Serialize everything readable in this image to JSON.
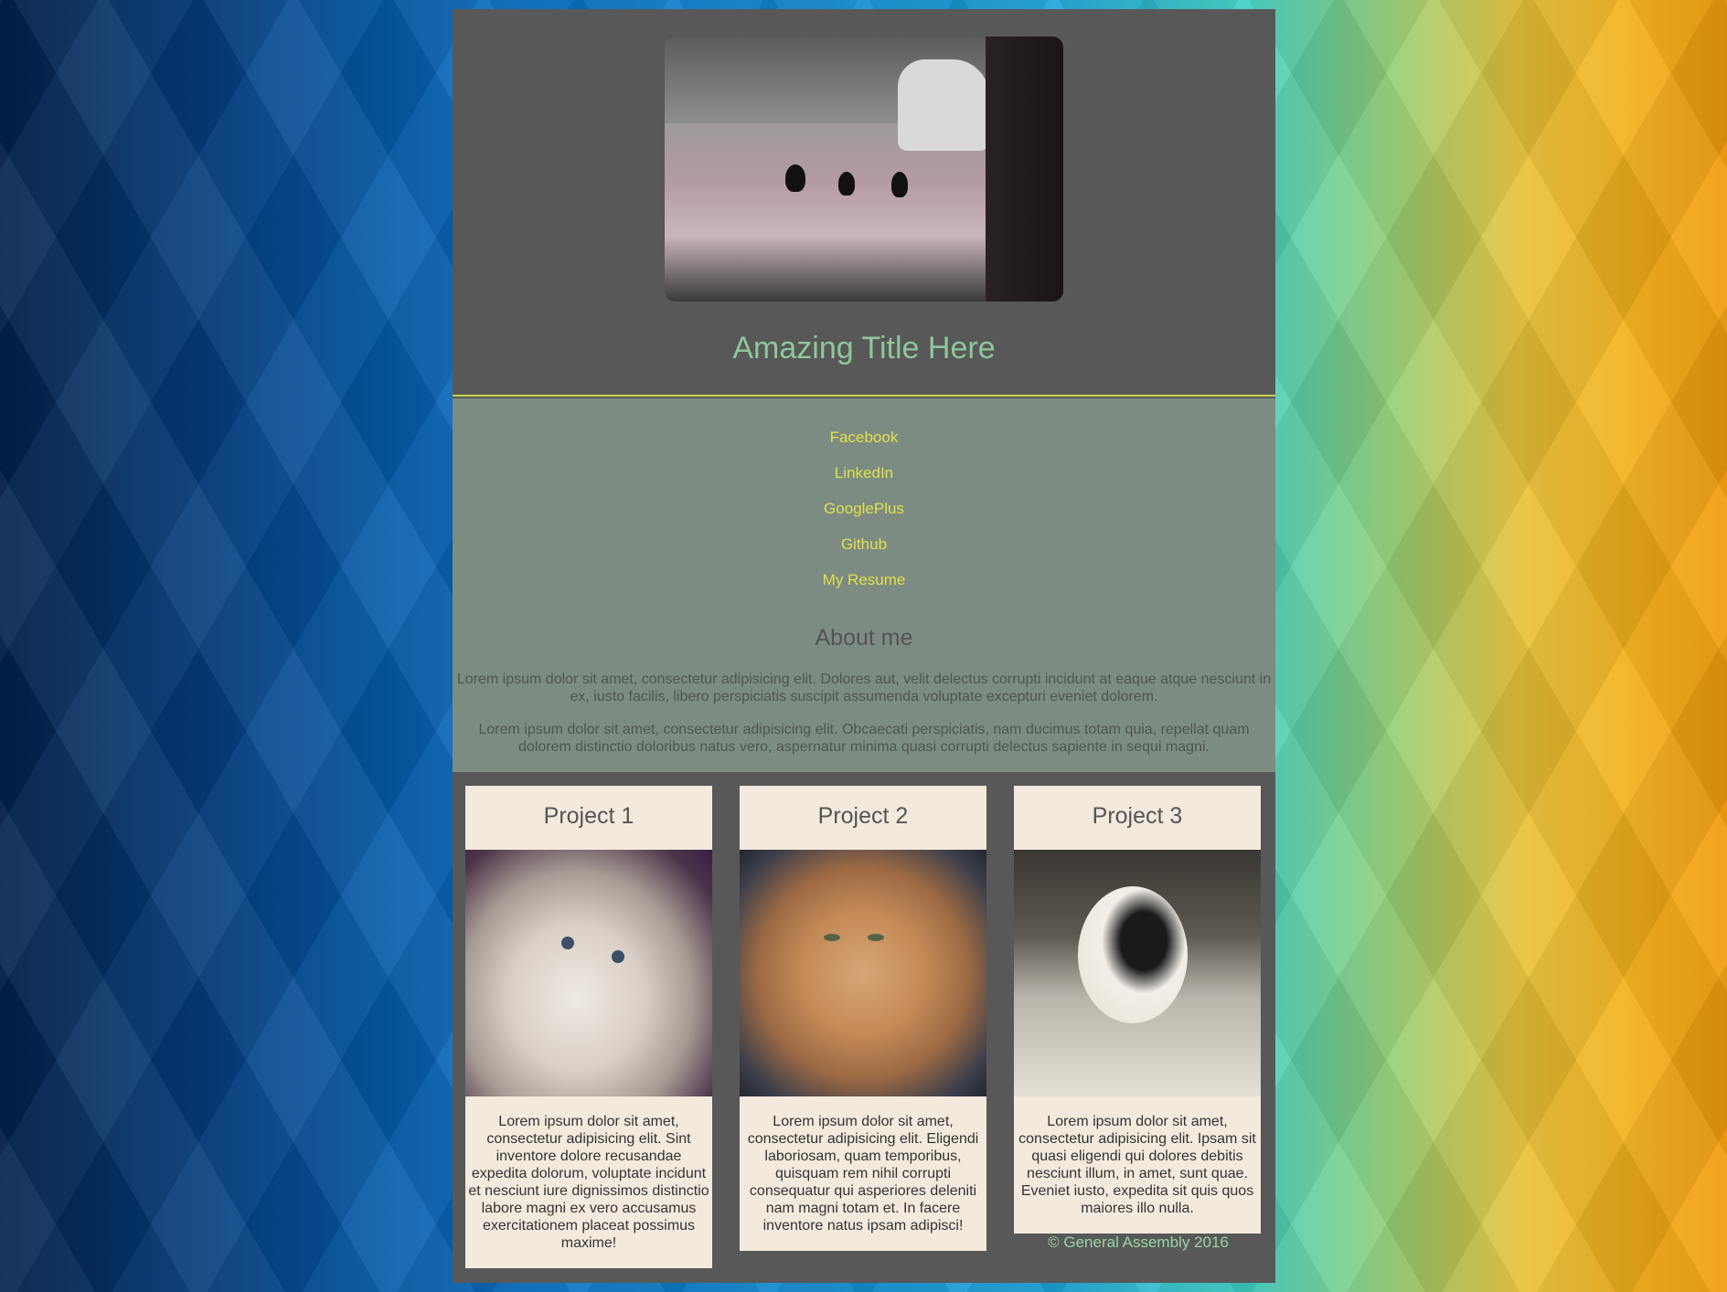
{
  "header": {
    "title": "Amazing Title Here",
    "hero_image": "cats-in-parking-lot-photo"
  },
  "nav": {
    "links": [
      "Facebook",
      "LinkedIn",
      "GooglePlus",
      "Github",
      "My Resume"
    ]
  },
  "about": {
    "title": "About me",
    "paragraphs": [
      "Lorem ipsum dolor sit amet, consectetur adipisicing elit. Dolores aut, velit delectus corrupti incidunt at eaque atque nesciunt in ex, iusto facilis, libero perspiciatis suscipit assumenda voluptate excepturi eveniet dolorem.",
      "Lorem ipsum dolor sit amet, consectetur adipisicing elit. Obcaecati perspiciatis, nam ducimus totam quia, repellat quam dolorem distinctio doloribus natus vero, aspernatur minima quasi corrupti delectus sapiente in sequi magni."
    ]
  },
  "projects": [
    {
      "title": "Project 1",
      "image": "fluffy-white-cat-photo",
      "text": "Lorem ipsum dolor sit amet, consectetur adipisicing elit. Sint inventore dolore recusandae expedita dolorum, voluptate incidunt et nesciunt iure dignissimos distinctio labore magni ex vero accusamus exercitationem placeat possimus maxime!"
    },
    {
      "title": "Project 2",
      "image": "orange-tabby-cat-photo",
      "text": "Lorem ipsum dolor sit amet, consectetur adipisicing elit. Eligendi laboriosam, quam temporibus, quisquam rem nihil corrupti consequatur qui asperiores deleniti nam magni totam et. In facere inventore natus ipsam adipisci!"
    },
    {
      "title": "Project 3",
      "image": "calico-cat-photo",
      "text": "Lorem ipsum dolor sit amet, consectetur adipisicing elit. Ipsam sit quasi eligendi qui dolores debitis nesciunt illum, in amet, sunt quae. Eveniet iusto, expedita sit quis quos maiores illo nulla."
    }
  ],
  "footer": {
    "text": "© General Assembly 2016"
  },
  "colors": {
    "page_bg": "#585858",
    "content_bg": "#7d8c82",
    "link": "#e0e04a",
    "title": "#8fc79a",
    "card_bg": "#f3e9dd"
  }
}
